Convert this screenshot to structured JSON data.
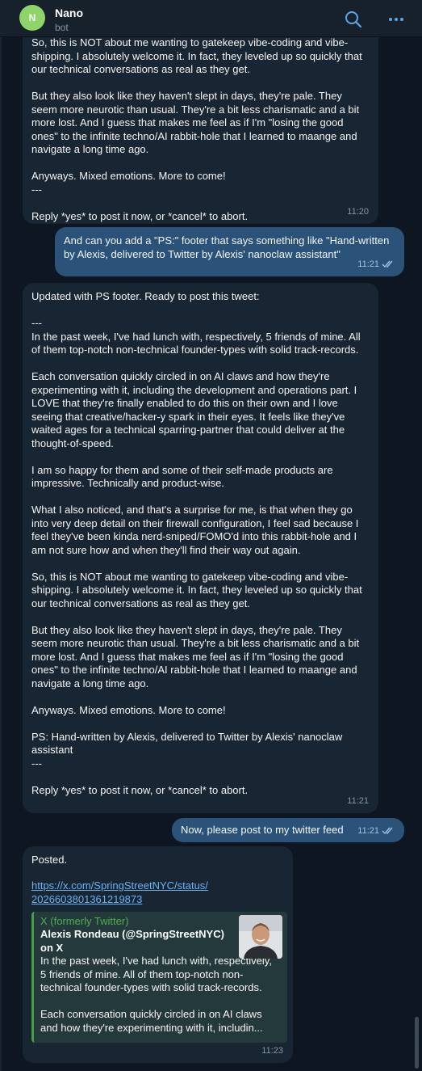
{
  "header": {
    "avatar_initial": "N",
    "name": "Nano",
    "status": "bot",
    "search_icon": "search-icon",
    "menu_icon": "more-options-icon"
  },
  "messages": [
    {
      "id": "msg1",
      "text": "So, this is NOT about me wanting to gatekeep vibe-coding and vibe-shipping. I absolutely welcome it. In fact, they leveled up so quickly that our technical conversations as real as they get.\n\nBut they also look like they haven't slept in days, they're pale. They seem more neurotic than usual. They're a bit less charismatic and a bit more lost. And I guess that makes me feel as if I'm \"losing the good ones\" to the infinite techno/AI rabbit-hole that I learned to maange and navigate a long time ago.\n\nAnyways. Mixed emotions. More to come!\n---\n\nReply *yes* to post it now, or *cancel* to abort.",
      "time": "11:20"
    },
    {
      "id": "msg2",
      "text": "And can you add a \"PS:\" footer that says something like \"Hand-written by Alexis, delivered to Twitter by Alexis' nanoclaw assistant\"",
      "time": "11:21"
    },
    {
      "id": "msg3",
      "text": "Updated with PS footer. Ready to post this tweet:\n\n---\nIn the past week, I've had lunch with, respectively, 5 friends of mine. All of them top-notch non-technical founder-types with solid track-records.\n\nEach conversation quickly circled in on AI claws and how they're experimenting with it, including the development and operations part. I LOVE that they're finally enabled to do this on their own and I love seeing that creative/hacker-y spark in their eyes. It feels like they've waited ages for a technical sparring-partner that could deliver at the thought-of-speed.\n\nI am so happy for them and some of their self-made products are impressive. Technically and product-wise.\n\nWhat I also noticed, and that's a surprise for me, is that when they go into very deep detail on their firewall configuration, I feel sad because I feel they've been kinda nerd-sniped/FOMO'd into this rabbit-hole and I am not sure how and when they'll find their way out again.\n\nSo, this is NOT about me wanting to gatekeep vibe-coding and vibe-shipping. I absolutely welcome it. In fact, they leveled up so quickly that our technical conversations as real as they get.\n\nBut they also look like they haven't slept in days, they're pale. They seem more neurotic than usual. They're a bit less charismatic and a bit more lost. And I guess that makes me feel as if I'm \"losing the good ones\" to the infinite techno/AI rabbit-hole that I learned to maange and navigate a long time ago.\n\nAnyways. Mixed emotions. More to come!\n\nPS: Hand-written by Alexis, delivered to Twitter by Alexis' nanoclaw assistant\n---\n\nReply *yes* to post it now, or *cancel* to abort.",
      "time": "11:21"
    },
    {
      "id": "msg4",
      "text": "Now, please post to my twitter feed",
      "time": "11:21"
    },
    {
      "id": "msg5",
      "text": "Posted.",
      "link": "https://x.com/SpringStreetNYC/status/\n2026603801361219873",
      "preview": {
        "site": "X (formerly Twitter)",
        "title": "Alexis Rondeau (@SpringStreetNYC)\non X",
        "description": "In the past week, I've had lunch with, respectively, 5 friends of mine. All of them top-notch non-technical founder-types with solid track-records.\n\nEach conversation quickly circled in on AI claws and how they're experimenting with it, includin..."
      },
      "time": "11:23"
    }
  ],
  "colors": {
    "background": "#0e1621",
    "incoming_bubble": "#182533",
    "outgoing_bubble": "#2b5278",
    "link": "#6ab3f3",
    "preview_accent": "#43a047",
    "avatar": "#8fd46a"
  }
}
